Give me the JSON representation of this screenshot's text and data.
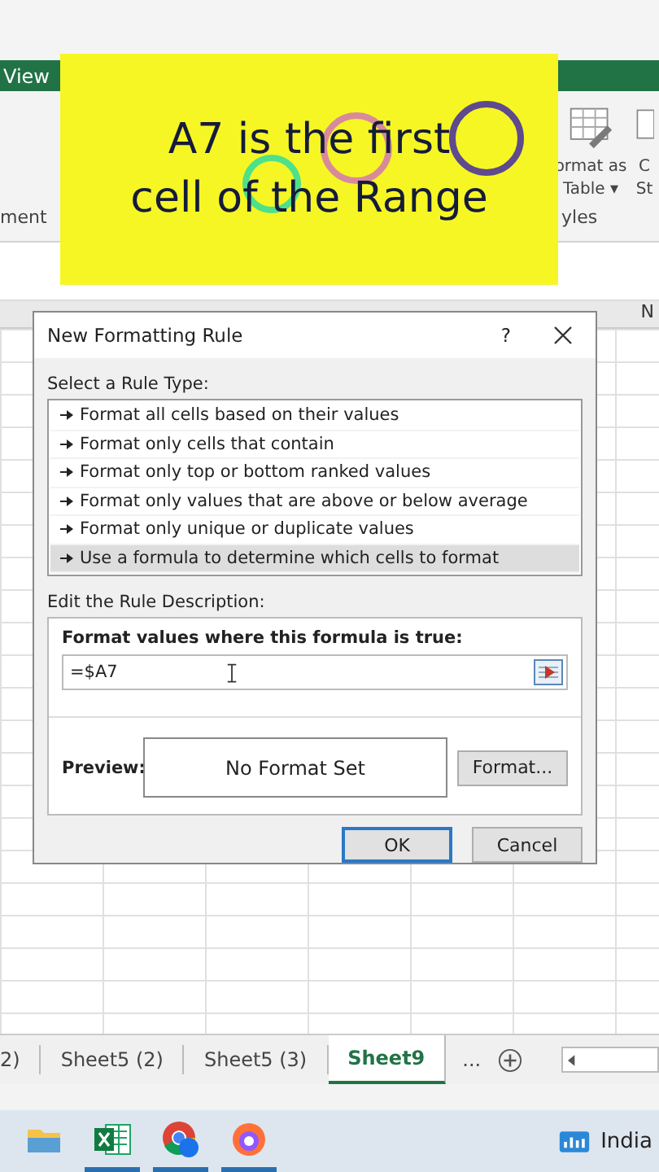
{
  "ribbon": {
    "tabs": [
      {
        "label": "View",
        "selected": false
      }
    ],
    "group_labels": [
      "ment",
      "yles"
    ],
    "buttons": [
      {
        "lines": [
          "ormat as",
          "Table ▾"
        ]
      },
      {
        "lines": [
          "C",
          "St"
        ]
      }
    ]
  },
  "caption": {
    "lines": [
      "A7 is the first",
      "cell of the Range"
    ]
  },
  "grid": {
    "column_headers": [
      "N"
    ]
  },
  "dialog": {
    "title": "New Formatting Rule",
    "help": "?",
    "rule_type_label": "Select a Rule Type:",
    "rule_types": [
      {
        "label": "Format all cells based on their values",
        "selected": false
      },
      {
        "label": "Format only cells that contain",
        "selected": false
      },
      {
        "label": "Format only top or bottom ranked values",
        "selected": false
      },
      {
        "label": "Format only values that are above or below average",
        "selected": false
      },
      {
        "label": "Format only unique or duplicate values",
        "selected": false
      },
      {
        "label": "Use a formula to determine which cells to format",
        "selected": true
      }
    ],
    "description_label": "Edit the Rule Description:",
    "formula_label": "Format values where this formula is true:",
    "formula": "=$A7",
    "preview_label": "Preview:",
    "preview_text": "No Format Set",
    "buttons": [
      {
        "label": "Format...",
        "kind": "format"
      },
      {
        "label": "OK",
        "kind": "default"
      },
      {
        "label": "Cancel",
        "kind": "normal"
      }
    ]
  },
  "sheet_tabs": [
    {
      "label": "2)",
      "selected": false
    },
    {
      "label": "Sheet5 (2)",
      "selected": false
    },
    {
      "label": "Sheet5 (3)",
      "selected": false
    },
    {
      "label": "Sheet9",
      "selected": true
    }
  ],
  "sheet_more": "...",
  "taskbar": {
    "apps": [
      {
        "kind": "folder",
        "active": false
      },
      {
        "kind": "excel",
        "active": true
      },
      {
        "kind": "chrome",
        "active": true
      },
      {
        "kind": "firefox",
        "active": true
      }
    ],
    "news": "India"
  }
}
